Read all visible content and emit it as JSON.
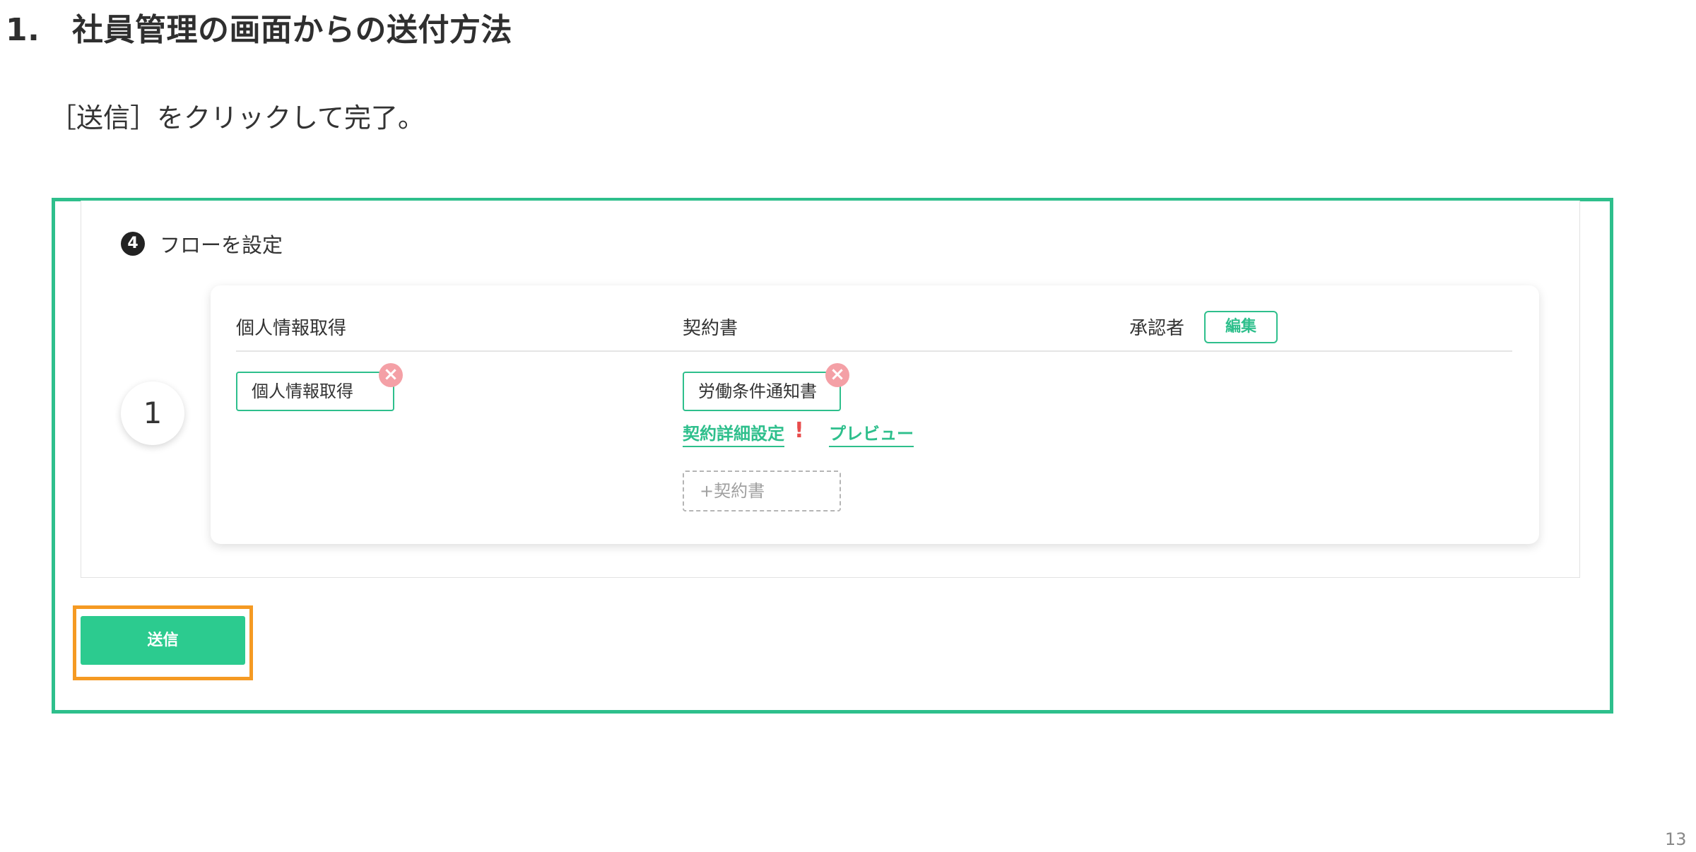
{
  "heading": {
    "number": "1.",
    "title": "社員管理の画面からの送付方法"
  },
  "instruction": "［送信］をクリックして完了。",
  "section": {
    "step_number": "4",
    "title": "フローを設定"
  },
  "flow": {
    "order": "1",
    "columns": {
      "personal_info": "個人情報取得",
      "contract": "契約書",
      "approver": "承認者"
    },
    "edit_label": "編集",
    "personal_info_chip": "個人情報取得",
    "contract_chip": "労働条件通知書",
    "remove_icon": "×",
    "contract_detail_link": "契約詳細設定",
    "warning_mark": "!",
    "preview_link": "プレビュー",
    "add_contract_label": "+契約書"
  },
  "send_button": "送信",
  "page_number": "13",
  "colors": {
    "accent_green": "#2ebf8c",
    "highlight_orange": "#f59a23",
    "remove_pink": "#f4a0a6",
    "warning_red": "#e84c4c"
  }
}
